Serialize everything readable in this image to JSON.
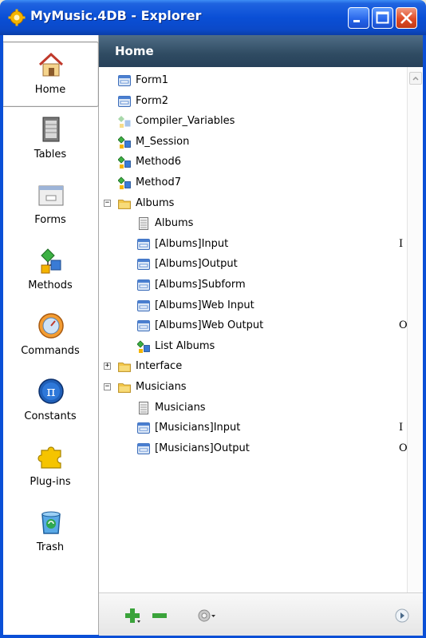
{
  "window": {
    "title": "MyMusic.4DB - Explorer"
  },
  "sidebar": {
    "items": [
      {
        "label": "Home",
        "icon": "home-icon"
      },
      {
        "label": "Tables",
        "icon": "tables-icon"
      },
      {
        "label": "Forms",
        "icon": "forms-icon"
      },
      {
        "label": "Methods",
        "icon": "methods-icon"
      },
      {
        "label": "Commands",
        "icon": "commands-icon"
      },
      {
        "label": "Constants",
        "icon": "constants-icon"
      },
      {
        "label": "Plug-ins",
        "icon": "plugins-icon"
      },
      {
        "label": "Trash",
        "icon": "trash-icon"
      }
    ],
    "active": "Home"
  },
  "main": {
    "header": "Home",
    "tree": [
      {
        "label": "Form1",
        "icon": "form-icon",
        "level": 0
      },
      {
        "label": "Form2",
        "icon": "form-icon",
        "level": 0
      },
      {
        "label": "Compiler_Variables",
        "icon": "method-faded-icon",
        "level": 0
      },
      {
        "label": "M_Session",
        "icon": "method-icon",
        "level": 0
      },
      {
        "label": "Method6",
        "icon": "method-icon",
        "level": 0
      },
      {
        "label": "Method7",
        "icon": "method-icon",
        "level": 0
      },
      {
        "label": "Albums",
        "icon": "folder-icon",
        "level": 0,
        "expander": "−"
      },
      {
        "label": "Albums",
        "icon": "table-icon",
        "level": 1
      },
      {
        "label": "[Albums]Input",
        "icon": "form-icon",
        "level": 1,
        "trail": "I"
      },
      {
        "label": "[Albums]Output",
        "icon": "form-icon",
        "level": 1
      },
      {
        "label": "[Albums]Subform",
        "icon": "form-icon",
        "level": 1
      },
      {
        "label": "[Albums]Web Input",
        "icon": "form-icon",
        "level": 1
      },
      {
        "label": "[Albums]Web Output",
        "icon": "form-icon",
        "level": 1,
        "trail": "O"
      },
      {
        "label": "List Albums",
        "icon": "method-icon",
        "level": 1
      },
      {
        "label": "Interface",
        "icon": "folder-icon",
        "level": 0,
        "expander": "+"
      },
      {
        "label": "Musicians",
        "icon": "folder-icon",
        "level": 0,
        "expander": "−"
      },
      {
        "label": "Musicians",
        "icon": "table-icon",
        "level": 1
      },
      {
        "label": "[Musicians]Input",
        "icon": "form-icon",
        "level": 1,
        "trail": "I"
      },
      {
        "label": "[Musicians]Output",
        "icon": "form-icon",
        "level": 1,
        "trail": "O"
      }
    ]
  },
  "toolbar": {
    "buttons": [
      "add-icon",
      "remove-icon",
      "gear-icon",
      "next-icon"
    ]
  },
  "colors": {
    "titlebar": "#0a4fd6",
    "header": "#2f4b62",
    "folder": "#f2c649"
  }
}
